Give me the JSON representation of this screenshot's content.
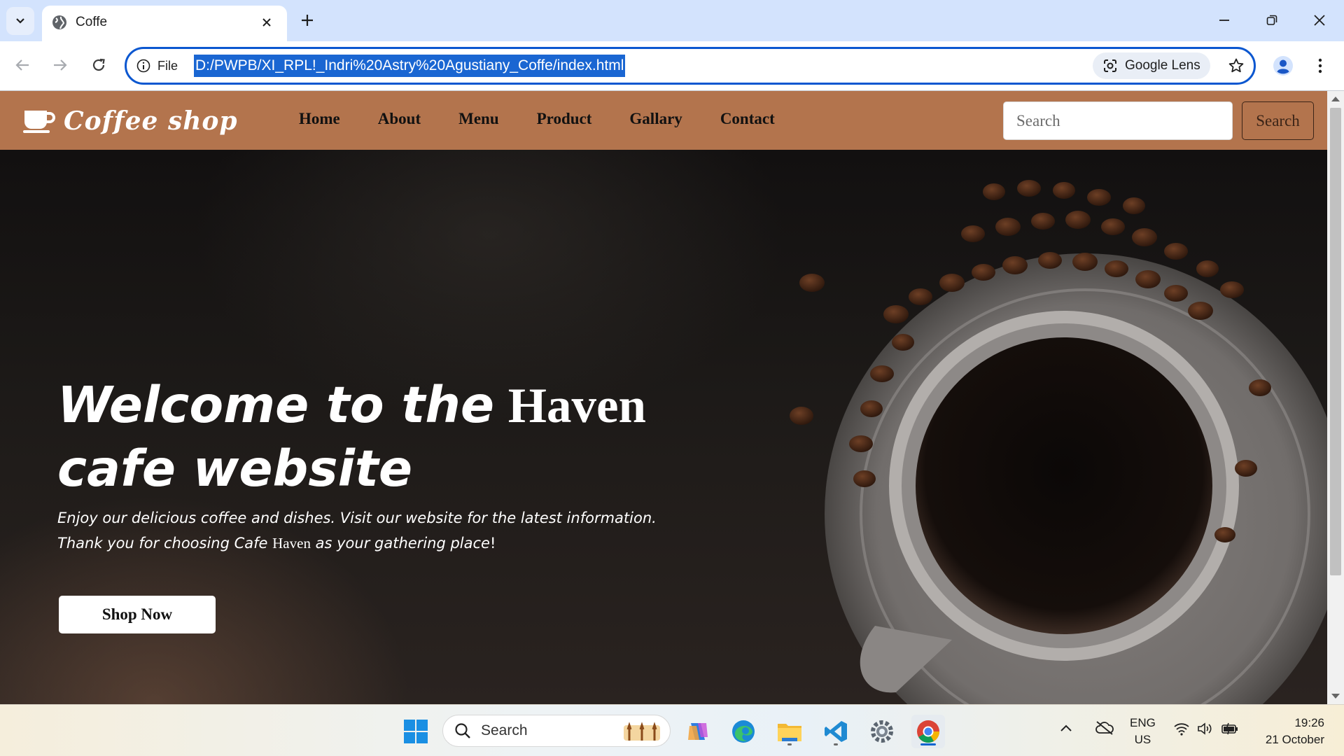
{
  "browser": {
    "tab": {
      "title": "Coffe"
    },
    "omnibox": {
      "site_info_label": "File",
      "url": "D:/PWPB/XI_RPL!_Indri%20Astry%20Agustiany_Coffe/index.html",
      "lens_label": "Google Lens"
    }
  },
  "site": {
    "brand": "Coffee shop",
    "nav": [
      "Home",
      "About",
      "Menu",
      "Product",
      "Gallary",
      "Contact"
    ],
    "search": {
      "placeholder": "Search",
      "button": "Search"
    },
    "hero": {
      "heading_italic_1": "Welcome to the",
      "heading_serif": "Haven",
      "heading_italic_2": "cafe website",
      "desc_line1": "Enjoy our delicious coffee and dishes. Visit our website for the latest information.",
      "desc_line2_a": "Thank you for choosing Cafe",
      "desc_line2_b": "Haven",
      "desc_line2_c": "as your gathering place",
      "desc_line2_d": "!",
      "cta": "Shop Now"
    },
    "colors": {
      "navbar": "#b3744d",
      "hero_text": "#ffffff"
    }
  },
  "taskbar": {
    "search_placeholder": "Search",
    "language": "ENG",
    "region": "US",
    "time": "19:26",
    "date": "21 October",
    "apps": [
      "start-icon",
      "search-icon",
      "copilot-icon",
      "edge-icon",
      "file-explorer-icon",
      "vscode-icon",
      "settings-icon",
      "chrome-icon"
    ]
  }
}
